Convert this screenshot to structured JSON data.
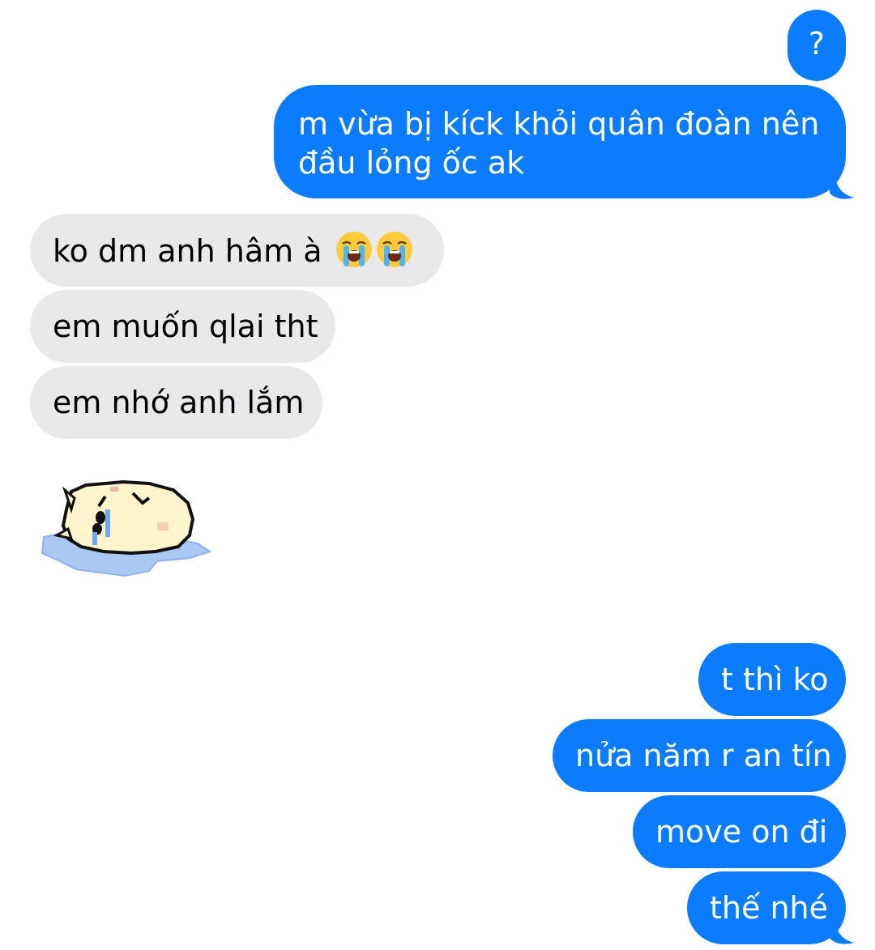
{
  "conversation": {
    "messages": [
      {
        "id": "m1",
        "side": "sent",
        "text": "?"
      },
      {
        "id": "m2",
        "side": "sent",
        "text": "m vừa bị kíck khỏi quân đoàn nên đầu lỏng ốc ak"
      },
      {
        "id": "m3",
        "side": "received",
        "text": "ko dm anh hâm à",
        "emoji": [
          "loudly-crying-face",
          "loudly-crying-face"
        ]
      },
      {
        "id": "m4",
        "side": "received",
        "text": "em muốn qlai tht"
      },
      {
        "id": "m5",
        "side": "received",
        "text": "em nhớ anh lắm"
      },
      {
        "id": "m6",
        "side": "received",
        "sticker": "crying-cat-puddle-sticker"
      },
      {
        "id": "m7",
        "side": "sent",
        "text": "t thì ko"
      },
      {
        "id": "m8",
        "side": "sent",
        "text": "nửa năm r an tín"
      },
      {
        "id": "m9",
        "side": "sent",
        "text": "move on đi"
      },
      {
        "id": "m10",
        "side": "sent",
        "text": "thế nhé"
      }
    ]
  },
  "colors": {
    "sent_bubble": "#0b7cff",
    "received_bubble": "#e9e9eb",
    "sent_text": "#ffffff",
    "received_text": "#000000",
    "background": "#ffffff"
  }
}
